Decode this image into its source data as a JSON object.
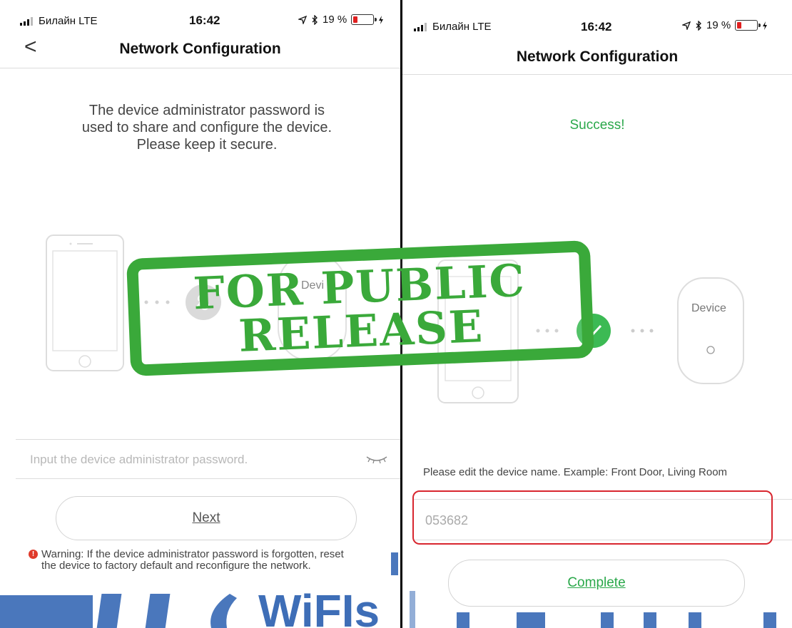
{
  "left": {
    "status": {
      "carrier": "Билайн  LTE",
      "time": "16:42",
      "battery": "19 %"
    },
    "title": "Network Configuration",
    "back_label": "<",
    "info_lines": [
      "The device administrator password is",
      "used to share and configure the device.",
      "Please keep it secure."
    ],
    "device_label": "Devi",
    "password_placeholder": "Input the device administrator password.",
    "next_label": "Next",
    "warning_text": "Warning: If the device administrator password is forgotten, reset the device to factory default and reconfigure the network."
  },
  "right": {
    "status": {
      "carrier": "Билайн  LTE",
      "time": "16:42",
      "battery": "19 %"
    },
    "title": "Network Configuration",
    "success_text": "Success!",
    "device_label": "Device",
    "edit_hint": "Please edit the device name. Example: Front Door, Living Room",
    "device_name_value": "053682",
    "complete_label": "Complete"
  },
  "stamp": {
    "line1": "FOR PUBLIC",
    "line2": "RELEASE"
  },
  "watermark_text": "WiFIs",
  "colors": {
    "success_green": "#2aa84a",
    "stamp_green": "#3aa93a",
    "highlight_red": "#d8262f",
    "battery_red": "#e02020",
    "watermark_blue": "#2a5fb0"
  }
}
